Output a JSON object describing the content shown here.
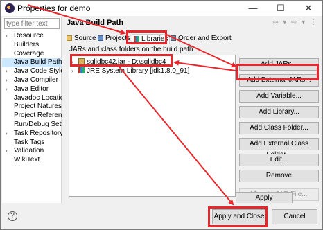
{
  "window": {
    "title": "Properties for demo",
    "minimize_glyph": "—",
    "maximize_glyph": "☐",
    "close_glyph": "✕"
  },
  "sidebar": {
    "filter_placeholder": "type filter text",
    "items": [
      {
        "label": "Resource",
        "expandable": true
      },
      {
        "label": "Builders",
        "expandable": false
      },
      {
        "label": "Coverage",
        "expandable": false
      },
      {
        "label": "Java Build Path",
        "expandable": false,
        "selected": true
      },
      {
        "label": "Java Code Style",
        "expandable": true
      },
      {
        "label": "Java Compiler",
        "expandable": true
      },
      {
        "label": "Java Editor",
        "expandable": true
      },
      {
        "label": "Javadoc Location",
        "expandable": false
      },
      {
        "label": "Project Natures",
        "expandable": false
      },
      {
        "label": "Project References",
        "expandable": false
      },
      {
        "label": "Run/Debug Settings",
        "expandable": false
      },
      {
        "label": "Task Repository",
        "expandable": true
      },
      {
        "label": "Task Tags",
        "expandable": false
      },
      {
        "label": "Validation",
        "expandable": true
      },
      {
        "label": "WikiText",
        "expandable": false
      }
    ]
  },
  "page": {
    "title": "Java Build Path",
    "nav_arrows": "⇦ ▾ ⇨ ▾ ⋮",
    "tabs": [
      {
        "label": "Source"
      },
      {
        "label": "Projects"
      },
      {
        "label": "Libraries",
        "active": true
      },
      {
        "label": "Order and Export"
      }
    ],
    "build_path_label": "JARs and class folders on the build path:",
    "entries": [
      {
        "label": "sqljdbc42.jar - D:\\sqljdbc4"
      },
      {
        "label": "JRE System Library [jdk1.8.0_91]"
      }
    ],
    "buttons": [
      {
        "label": "Add JARs...",
        "enabled": true
      },
      {
        "label": "Add External JARs...",
        "enabled": true
      },
      {
        "label": "Add Variable...",
        "enabled": true
      },
      {
        "label": "Add Library...",
        "enabled": true
      },
      {
        "label": "Add Class Folder...",
        "enabled": true
      },
      {
        "label": "Add External Class Folder...",
        "enabled": true
      },
      {
        "label": "Edit...",
        "enabled": true
      },
      {
        "label": "Remove",
        "enabled": true
      },
      {
        "label": "Migrate JAR File...",
        "enabled": false
      }
    ],
    "apply_label": "Apply"
  },
  "footer": {
    "help_glyph": "?",
    "apply_close_label": "Apply and Close",
    "cancel_label": "Cancel"
  },
  "colors": {
    "annotation_red": "#e8262b",
    "selection_blue": "#cce8ff"
  }
}
